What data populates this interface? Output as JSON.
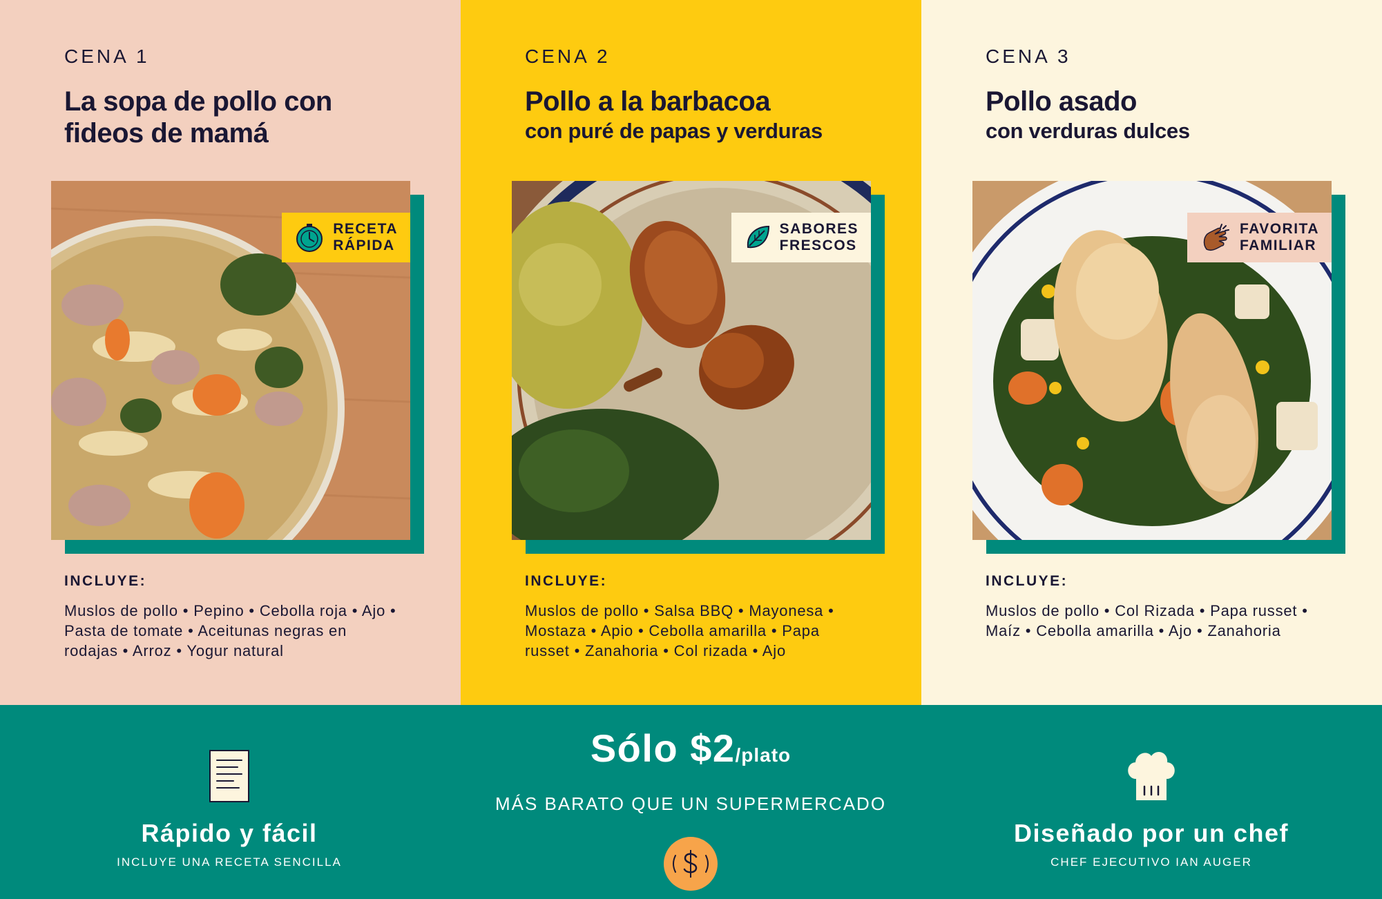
{
  "meals": [
    {
      "cena": "CENA 1",
      "title": "La sopa de pollo con fideos de mamá",
      "subtitle": "",
      "badge": "RECETA\nRÁPIDA",
      "badge_icon": "stopwatch-icon",
      "includes_label": "INCLUYE:",
      "ingredients": "Muslos de pollo • Pepino • Cebolla roja • Ajo • Pasta de tomate • Aceitunas negras en rodajas • Arroz • Yogur natural"
    },
    {
      "cena": "CENA 2",
      "title": "Pollo a la barbacoa",
      "subtitle": "con puré de papas y verduras",
      "badge": "SABORES\nFRESCOS",
      "badge_icon": "leaf-icon",
      "includes_label": "INCLUYE:",
      "ingredients": "Muslos de pollo • Salsa BBQ • Mayonesa • Mostaza • Apio • Cebolla amarilla • Papa russet • Zanahoria • Col rizada • Ajo"
    },
    {
      "cena": "CENA 3",
      "title": "Pollo asado",
      "subtitle": "con verduras dulces",
      "badge": "FAVORITA\nFAMILIAR",
      "badge_icon": "clapping-hands-icon",
      "includes_label": "INCLUYE:",
      "ingredients": "Muslos de pollo • Col Rizada • Papa russet • Maíz • Cebolla amarilla • Ajo • Zanahoria"
    }
  ],
  "footer": {
    "left": {
      "title": "Rápido y fácil",
      "subtitle": "INCLUYE UNA RECETA SENCILLA",
      "icon": "recipe-card-icon"
    },
    "center": {
      "price": "Sólo $2",
      "unit": "/plato",
      "subtitle": "MÁS BARATO QUE UN SUPERMERCADO",
      "icon": "coin-icon"
    },
    "right": {
      "title": "Diseñado por un chef",
      "subtitle": "CHEF EJECUTIVO IAN AUGER",
      "icon": "chef-hat-icon"
    }
  },
  "colors": {
    "col1_bg": "#f3d0bf",
    "col2_bg": "#fecb10",
    "col3_bg": "#fdf5de",
    "teal": "#008a7c",
    "text_dark": "#1a1733",
    "coin_orange": "#f7a44a"
  }
}
